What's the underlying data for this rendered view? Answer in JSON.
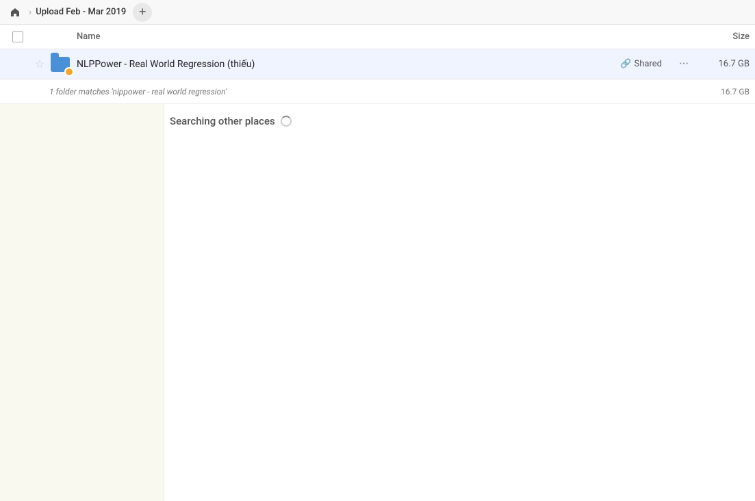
{
  "header": {
    "home_icon": "🏠",
    "separator": "›",
    "breadcrumb_label": "Upload Feb - Mar 2019",
    "add_btn_label": "+"
  },
  "columns": {
    "name_label": "Name",
    "size_label": "Size"
  },
  "file_row": {
    "name": "NLPPower - Real World Regression (thiếu)",
    "shared_label": "Shared",
    "more_label": "···",
    "size": "16.7 GB",
    "star_icon": "☆",
    "link_icon": "🔗"
  },
  "match_info": {
    "text": "1 folder matches 'nippower - real world regression'",
    "size": "16.7 GB"
  },
  "searching": {
    "label": "Searching other places"
  }
}
